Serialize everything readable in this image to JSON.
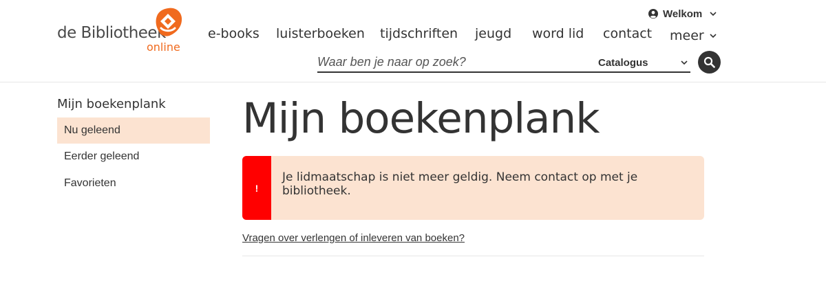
{
  "brand": {
    "name": "de Bibliotheek",
    "sub": "online",
    "accent": "#f06a1e"
  },
  "header": {
    "welcome_label": "Welkom",
    "nav": [
      {
        "label": "e-books"
      },
      {
        "label": "luisterboeken"
      },
      {
        "label": "tijdschriften"
      },
      {
        "label": "jeugd"
      },
      {
        "label": "word lid"
      },
      {
        "label": "contact"
      },
      {
        "label": "meer"
      }
    ],
    "search": {
      "placeholder": "Waar ben je naar op zoek?",
      "value": "",
      "scope": "Catalogus"
    },
    "icons": [
      "user-icon",
      "chevron-down-icon",
      "search-icon"
    ]
  },
  "sidebar": {
    "title": "Mijn boekenplank",
    "items": [
      {
        "label": "Nu geleend",
        "active": true
      },
      {
        "label": "Eerder geleend",
        "active": false
      },
      {
        "label": "Favorieten",
        "active": false
      }
    ]
  },
  "main": {
    "title": "Mijn boekenplank",
    "alert": {
      "icon": "!",
      "message": "Je lidmaatschap is niet meer geldig. Neem contact op met je bibliotheek.",
      "color": "#ff0000",
      "background": "#fce3d1"
    },
    "help_link": "Vragen over verlengen of inleveren van boeken?"
  }
}
